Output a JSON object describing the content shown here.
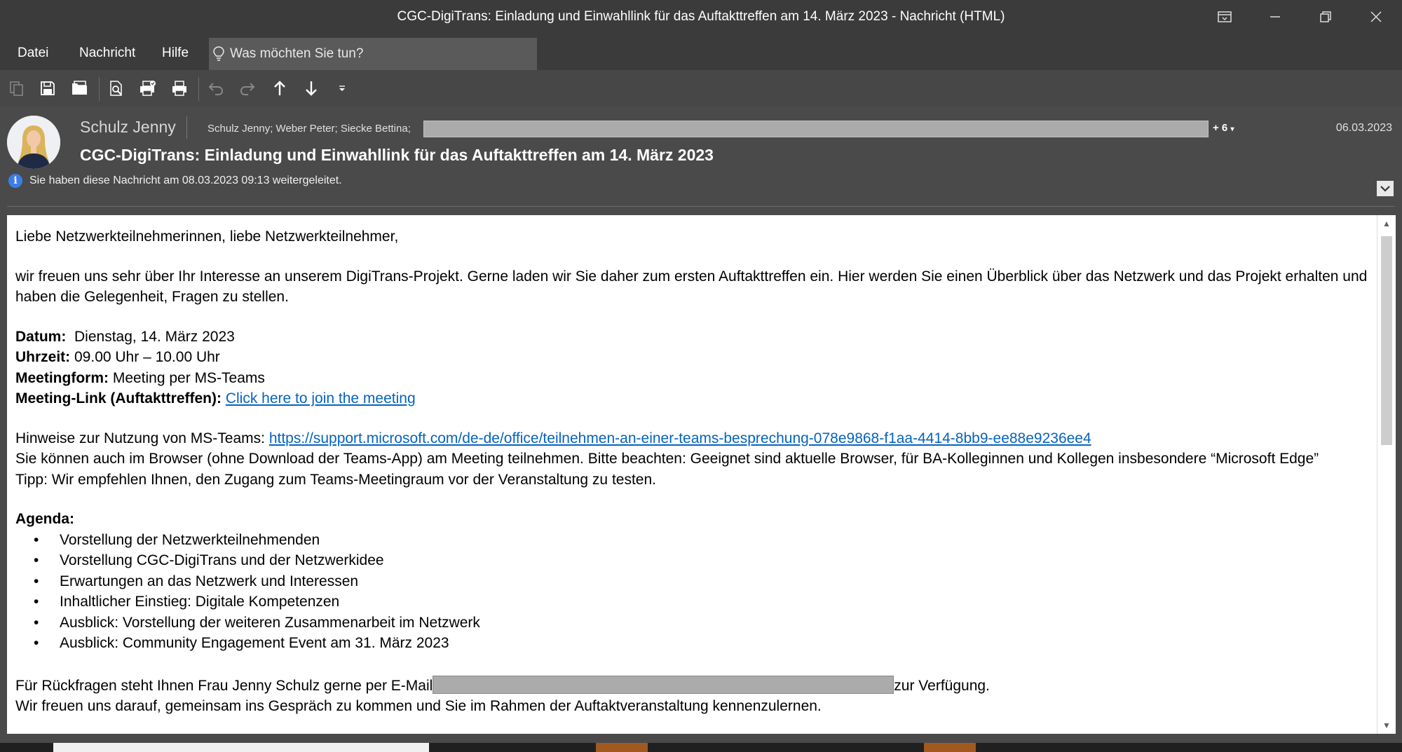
{
  "window": {
    "title": "CGC-DigiTrans: Einladung und Einwahllink für das Auftakttreffen am 14. März 2023  -  Nachricht (HTML)"
  },
  "menu": {
    "items": [
      "Datei",
      "Nachricht",
      "Hilfe"
    ],
    "tell_me_placeholder": "Was möchten Sie tun?"
  },
  "toolbar": {
    "icons": [
      "copy-icon",
      "save-icon",
      "folder-icon",
      "print-preview-icon",
      "print-settings-icon",
      "print-icon",
      "undo-icon",
      "redo-icon",
      "arrow-up-icon",
      "arrow-down-icon",
      "customize-icon"
    ]
  },
  "message": {
    "sender": "Schulz Jenny",
    "recipients": "Schulz Jenny; Weber Peter; Siecke Bettina;",
    "more_recipients": "+ 6",
    "date": "06.03.2023",
    "subject": "CGC-DigiTrans: Einladung und Einwahllink für das Auftakttreffen am 14. März 2023",
    "info": "Sie haben diese Nachricht am 08.03.2023 09:13 weitergeleitet."
  },
  "body": {
    "greeting": "Liebe Netzwerkteilnehmerinnen, liebe Netzwerkteilnehmer,",
    "intro": "wir freuen uns sehr über Ihr Interesse an unserem DigiTrans-Projekt. Gerne laden wir Sie daher zum ersten Auftakttreffen ein. Hier werden Sie einen Überblick über das Netzwerk und das Projekt erhalten und haben die Gelegenheit, Fragen zu stellen.",
    "date_label": "Datum:",
    "date_value": "  Dienstag, 14. März 2023",
    "time_label": "Uhrzeit:",
    "time_value": " 09.00 Uhr – 10.00 Uhr",
    "form_label": "Meetingform:",
    "form_value": " Meeting per MS-Teams",
    "link_label": "Meeting-Link (Auftakttreffen):",
    "link_text": "Click here to join the meeting",
    "teams_hint_label": "Hinweise zur Nutzung von MS-Teams: ",
    "teams_hint_url": "https://support.microsoft.com/de-de/office/teilnehmen-an-einer-teams-besprechung-078e9868-f1aa-4414-8bb9-ee88e9236ee4",
    "browser_note": "Sie können auch im Browser (ohne Download der Teams-App) am Meeting teilnehmen. Bitte beachten: Geeignet sind aktuelle Browser, für BA-Kolleginnen und Kollegen insbesondere “Microsoft Edge”",
    "tip": "Tipp: Wir empfehlen Ihnen, den Zugang zum Teams-Meetingraum vor der Veranstaltung zu testen.",
    "agenda_label": "Agenda:",
    "agenda": [
      "Vorstellung der Netzwerkteilnehmenden",
      "Vorstellung CGC-DigiTrans und der Netzwerkidee",
      "Erwartungen an das Netzwerk und Interessen",
      "Inhaltlicher Einstieg: Digitale Kompetenzen",
      "Ausblick: Vorstellung der weiteren Zusammenarbeit im Netzwerk",
      "Ausblick: Community Engagement Event am 31. März 2023"
    ],
    "contact_before": "Für Rückfragen steht Ihnen Frau Jenny Schulz gerne per E-Mail",
    "contact_after": "zur Verfügung.",
    "closing": "Wir freuen uns darauf, gemeinsam ins Gespräch zu kommen und Sie im Rahmen der Auftaktveranstaltung kennenzulernen."
  }
}
